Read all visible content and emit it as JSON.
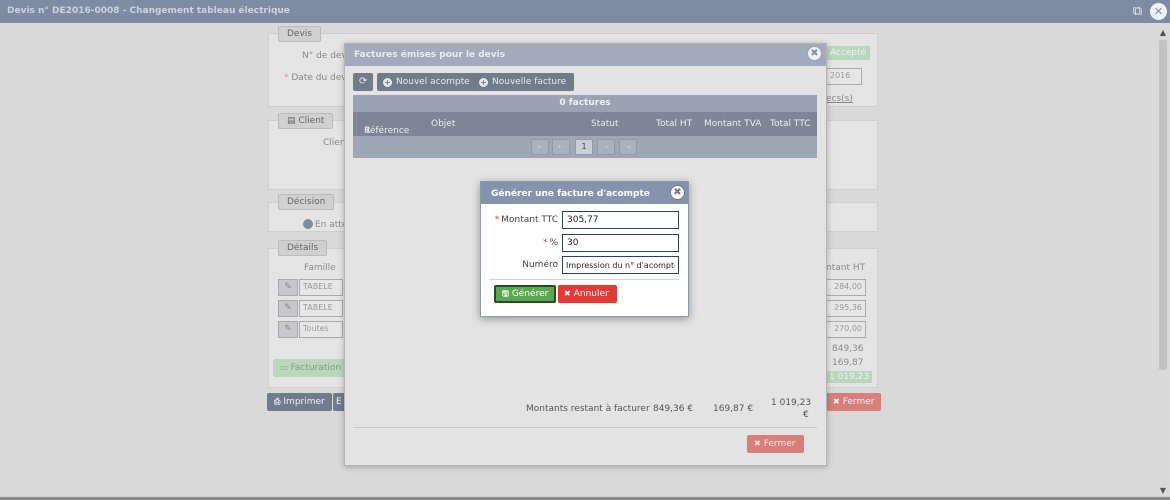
{
  "window": {
    "title": "Devis n° DE2016-0008 - Changement tableau électrique"
  },
  "background": {
    "devis_legend": "Devis",
    "num_label": "N° de devis",
    "date_label": "Date du devis",
    "status_badge": "Accepté",
    "date_value": "2016",
    "link_fragment": "ecs(s)",
    "client_legend": "Client",
    "client_label": "Client",
    "decision_legend": "Décision",
    "decision_value": "En atte",
    "details_legend": "Détails",
    "famille_header": "Famille",
    "montant_header": "ntant HT",
    "rows": [
      {
        "famille": "TABELE",
        "montant": "284,00"
      },
      {
        "famille": "TABELE",
        "montant": "295,36"
      },
      {
        "famille": "Toutes",
        "montant": "270,00"
      }
    ],
    "total_ht": "849,36",
    "total_tva": "169,87",
    "total_ttc": "1 019,23",
    "facturation_label": "Facturation",
    "imprimer_label": "Imprimer",
    "fermer_label": "Fermer"
  },
  "factures_modal": {
    "title": "Factures émises pour le devis",
    "nouvel_acompte": "Nouvel acompte",
    "nouvelle_facture": "Nouvelle facture",
    "count_label": "0 factures",
    "columns": [
      "Référence",
      "Objet",
      "Statut",
      "Total HT",
      "Montant TVA",
      "Total TTC"
    ],
    "current_page": "1",
    "totals_label": "Montants restant à facturer",
    "total_ht": "849,36 €",
    "total_tva": "169,87 €",
    "total_ttc_line1": "1 019,23",
    "total_ttc_line2": "€",
    "fermer_label": "Fermer"
  },
  "acompte_dialog": {
    "title": "Générer une facture d'acompte",
    "montant_label": "Montant TTC",
    "montant_value": "305,77",
    "percent_label": "%",
    "percent_value": "30",
    "numero_label": "Numéro",
    "numero_value": "Impression du n° d'acompte",
    "generer_label": "Générer",
    "annuler_label": "Annuler"
  },
  "colors": {
    "header": "#8693ad",
    "generer": "#5aa74f",
    "annuler": "#e53935",
    "fermer": "#d97f7b"
  }
}
